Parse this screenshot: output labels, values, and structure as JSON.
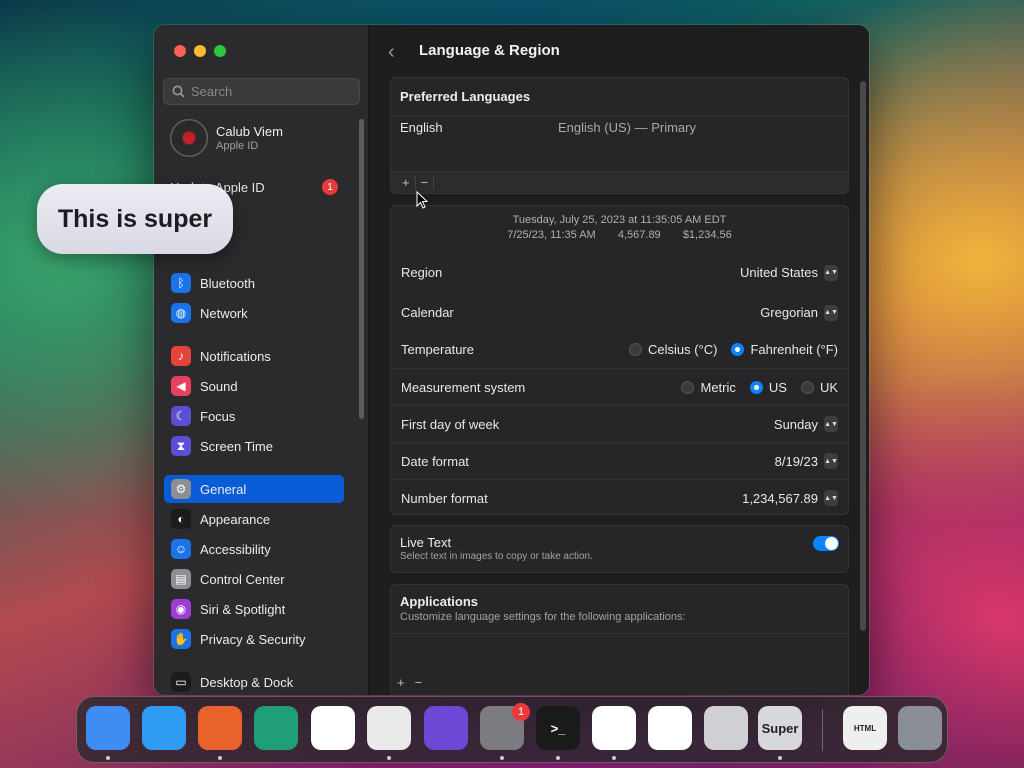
{
  "sidebar": {
    "search_placeholder": "Search",
    "user": {
      "name": "Calub Viem",
      "subtitle": "Apple ID"
    },
    "update": {
      "label": "Update Apple ID",
      "badge": "1"
    },
    "items": [
      {
        "label": "Bluetooth",
        "icon": "bluetooth-icon",
        "color": "#1a73e8"
      },
      {
        "label": "Network",
        "icon": "globe-icon",
        "color": "#1a73e8"
      },
      {
        "label": "Notifications",
        "icon": "bell-icon",
        "color": "#e5443a"
      },
      {
        "label": "Sound",
        "icon": "speaker-icon",
        "color": "#e5405e"
      },
      {
        "label": "Focus",
        "icon": "moon-icon",
        "color": "#5b4fd6"
      },
      {
        "label": "Screen Time",
        "icon": "hourglass-icon",
        "color": "#5b4fd6"
      },
      {
        "label": "General",
        "icon": "gear-icon",
        "color": "#8e8e93",
        "active": true
      },
      {
        "label": "Appearance",
        "icon": "appearance-icon",
        "color": "#1c1c1c"
      },
      {
        "label": "Accessibility",
        "icon": "accessibility-icon",
        "color": "#1a73e8"
      },
      {
        "label": "Control Center",
        "icon": "control-center-icon",
        "color": "#8e8e93"
      },
      {
        "label": "Siri & Spotlight",
        "icon": "siri-icon",
        "color": "#9b3ed6"
      },
      {
        "label": "Privacy & Security",
        "icon": "hand-icon",
        "color": "#1a73e8"
      },
      {
        "label": "Desktop & Dock",
        "icon": "dock-icon",
        "color": "#1c1c1c"
      }
    ]
  },
  "main": {
    "title": "Language & Region",
    "preferred": {
      "title": "Preferred Languages",
      "lang": "English",
      "detail": "English (US) — Primary",
      "add": "+",
      "remove": "−"
    },
    "preview": {
      "line1": "Tuesday, July 25, 2023 at 11:35:05 AM EDT",
      "line2_date": "7/25/23, 11:35 AM",
      "line2_num": "4,567.89",
      "line2_cur": "$1,234.56"
    },
    "region": {
      "label": "Region",
      "value": "United States"
    },
    "calendar": {
      "label": "Calendar",
      "value": "Gregorian"
    },
    "temperature": {
      "label": "Temperature",
      "opt1": "Celsius (°C)",
      "opt2": "Fahrenheit (°F)",
      "selected": "Fahrenheit (°F)"
    },
    "measurement": {
      "label": "Measurement system",
      "opt1": "Metric",
      "opt2": "US",
      "opt3": "UK",
      "selected": "US"
    },
    "first_day": {
      "label": "First day of week",
      "value": "Sunday"
    },
    "date_format": {
      "label": "Date format",
      "value": "8/19/23"
    },
    "number_format": {
      "label": "Number format",
      "value": "1,234,567.89"
    },
    "live_text": {
      "title": "Live Text",
      "desc": "Select text in images to copy or take action.",
      "on": true
    },
    "applications": {
      "title": "Applications",
      "desc": "Customize language settings for the following applications:",
      "add": "+",
      "remove": "−"
    }
  },
  "overlay": {
    "bubble_text": "This is super"
  },
  "dock": {
    "apps": [
      {
        "name": "finder-icon",
        "color": "#3d8df5"
      },
      {
        "name": "safari-icon",
        "color": "#2e9cf2"
      },
      {
        "name": "firefox-icon",
        "color": "#e8622c"
      },
      {
        "name": "xcode-cloud-icon",
        "color": "#1f9e77"
      },
      {
        "name": "office-icon",
        "color": "#ffffff"
      },
      {
        "name": "chrome-icon",
        "color": "#e9e9e9"
      },
      {
        "name": "shortcuts-icon",
        "color": "#6b48d6"
      },
      {
        "name": "system-settings-icon",
        "color": "#7c7c80",
        "badge": "1"
      },
      {
        "name": "terminal-icon",
        "color": "#1a1a1a",
        "label": ">_"
      },
      {
        "name": "vscode-icon",
        "color": "#ffffff"
      },
      {
        "name": "visual-studio-icon",
        "color": "#ffffff"
      },
      {
        "name": "launchpad-icon",
        "color": "#d0d0d4"
      },
      {
        "name": "super-app-icon",
        "color": "#d8d8dc",
        "label": "Super"
      },
      {
        "name": "html-file-icon",
        "color": "#efefef",
        "label": "HTML"
      },
      {
        "name": "trash-icon",
        "color": "#8a8f96"
      }
    ]
  }
}
